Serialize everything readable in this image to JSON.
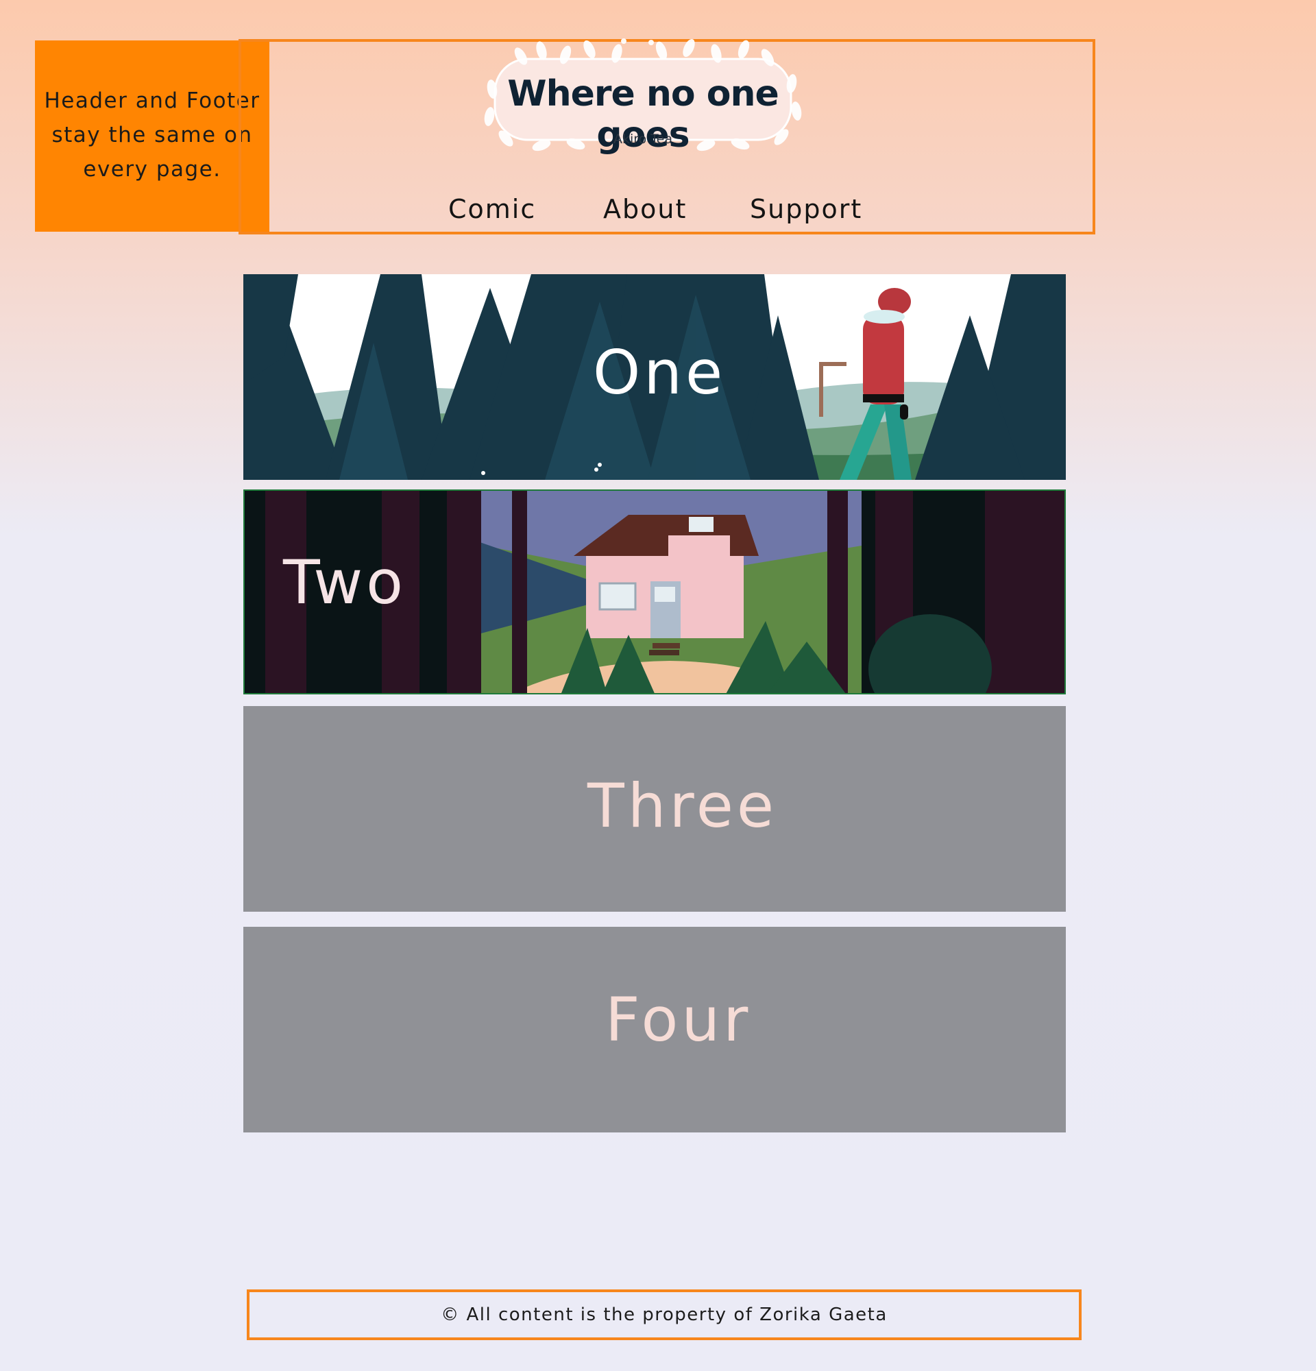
{
  "note": {
    "line1": "Header and Footer",
    "line2": "stay the same on",
    "line3": "every page."
  },
  "header": {
    "logo_title": "Where no one goes",
    "logo_subtitle": "Akiro Tea",
    "nav": [
      {
        "label": "Comic"
      },
      {
        "label": "About"
      },
      {
        "label": "Support"
      }
    ]
  },
  "panels": [
    {
      "label": "One",
      "has_image": true
    },
    {
      "label": "Two",
      "has_image": true
    },
    {
      "label": "Three",
      "has_image": false
    },
    {
      "label": "Four",
      "has_image": false
    }
  ],
  "footer": {
    "text": "© All content is the property of Zorika Gaeta"
  },
  "colors": {
    "accent_orange": "#ff8502",
    "border_orange": "#f7861c",
    "placeholder_gray": "#909196",
    "label_pink": "#f6dcd6"
  }
}
